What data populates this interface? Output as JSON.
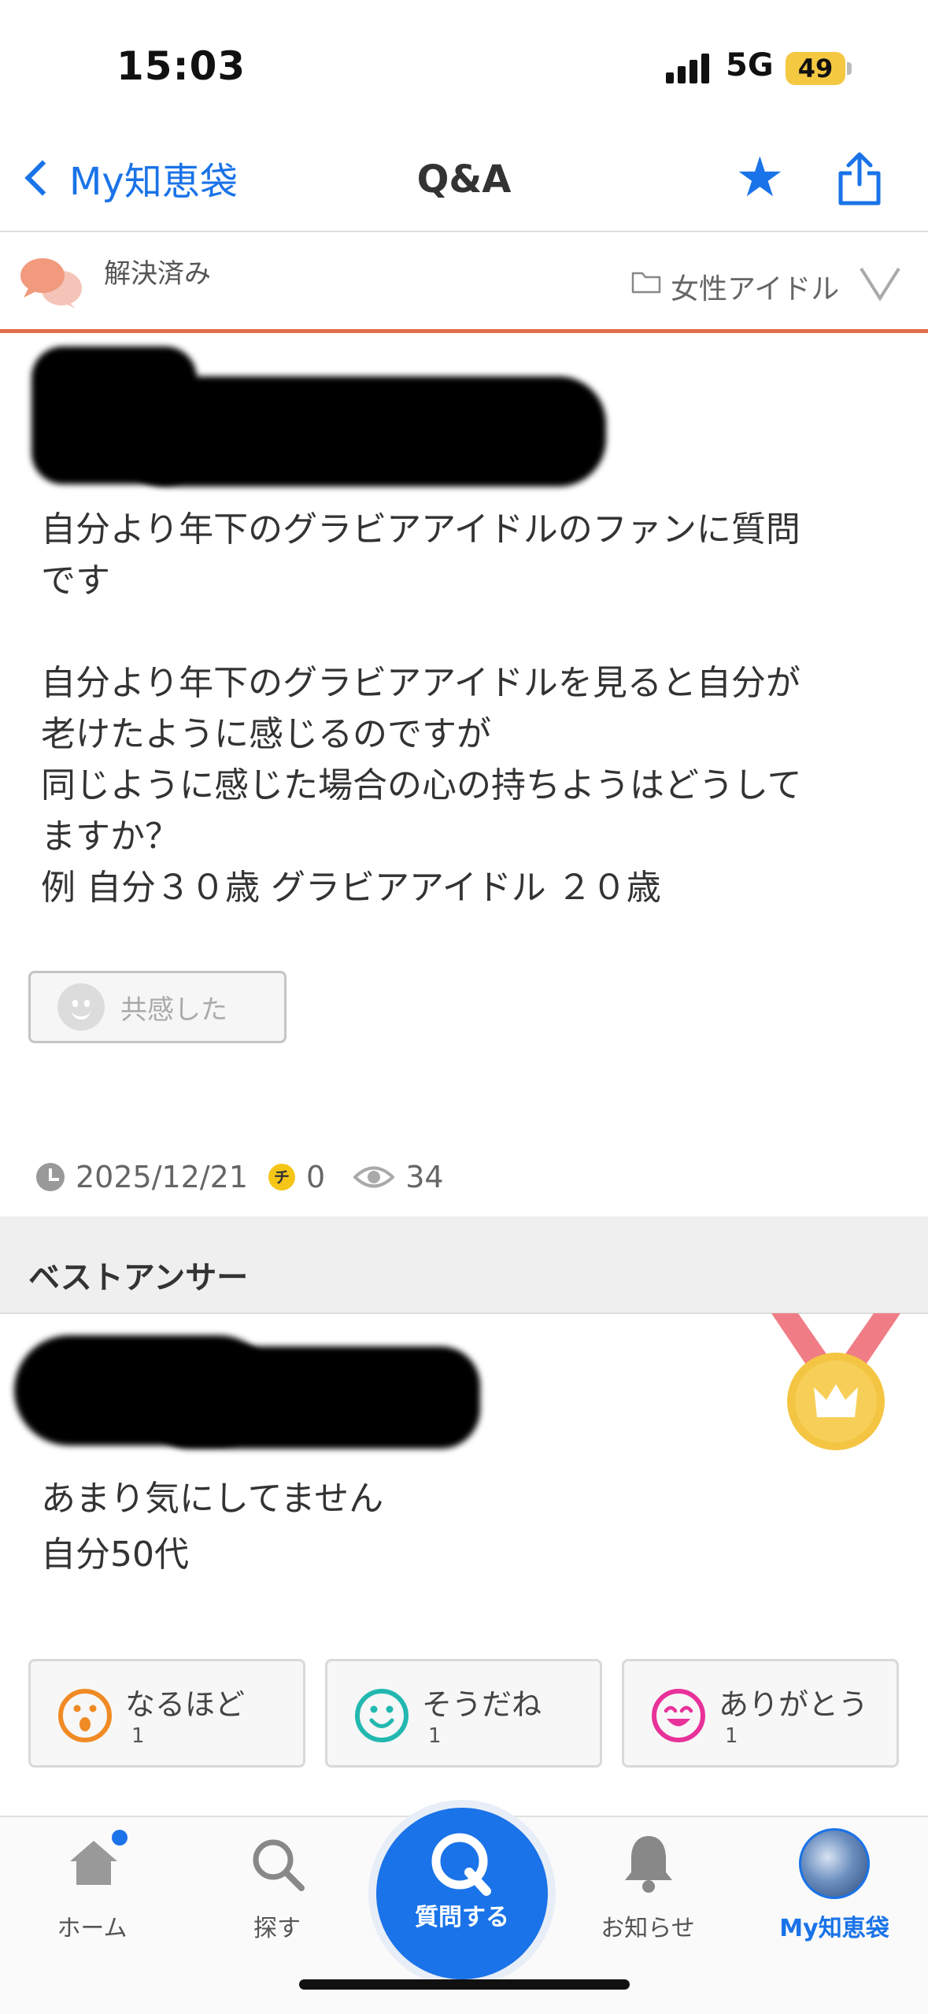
{
  "status_bar": {
    "time": "15:03",
    "network": "5G",
    "battery": "49"
  },
  "nav": {
    "back_label": "My知恵袋",
    "title": "Q&A"
  },
  "category_bar": {
    "status": "解決済み",
    "category": "女性アイドル"
  },
  "question": {
    "body": "自分より年下のグラビアアイドルのファンに質問\nです\n\n自分より年下のグラビアアイドルを見ると自分が\n老けたように感じるのですが\n同じように感じた場合の心の持ちようはどうして\nますか？\n例 自分３０歳 グラビアアイドル ２０歳",
    "empathy_label": "共感した",
    "date": "2025/12/21",
    "coin_symbol": "チ",
    "coins": "0",
    "views": "34"
  },
  "best_answer": {
    "heading": "ベストアンサー",
    "body": "あまり気にしてません\n自分50代",
    "reactions": [
      {
        "label": "なるほど",
        "count": "1",
        "color": "#f08a24"
      },
      {
        "label": "そうだね",
        "count": "1",
        "color": "#22b8b0"
      },
      {
        "label": "ありがとう",
        "count": "1",
        "color": "#e8329a"
      }
    ]
  },
  "tab_bar": {
    "home": "ホーム",
    "search": "探す",
    "ask": "質問する",
    "notifications": "お知らせ",
    "mypage": "My知恵袋"
  },
  "colors": {
    "accent": "#1a73e8",
    "orange": "#e26d4c",
    "medal_gold": "#f4c542",
    "ribbon": "#f07d86"
  }
}
